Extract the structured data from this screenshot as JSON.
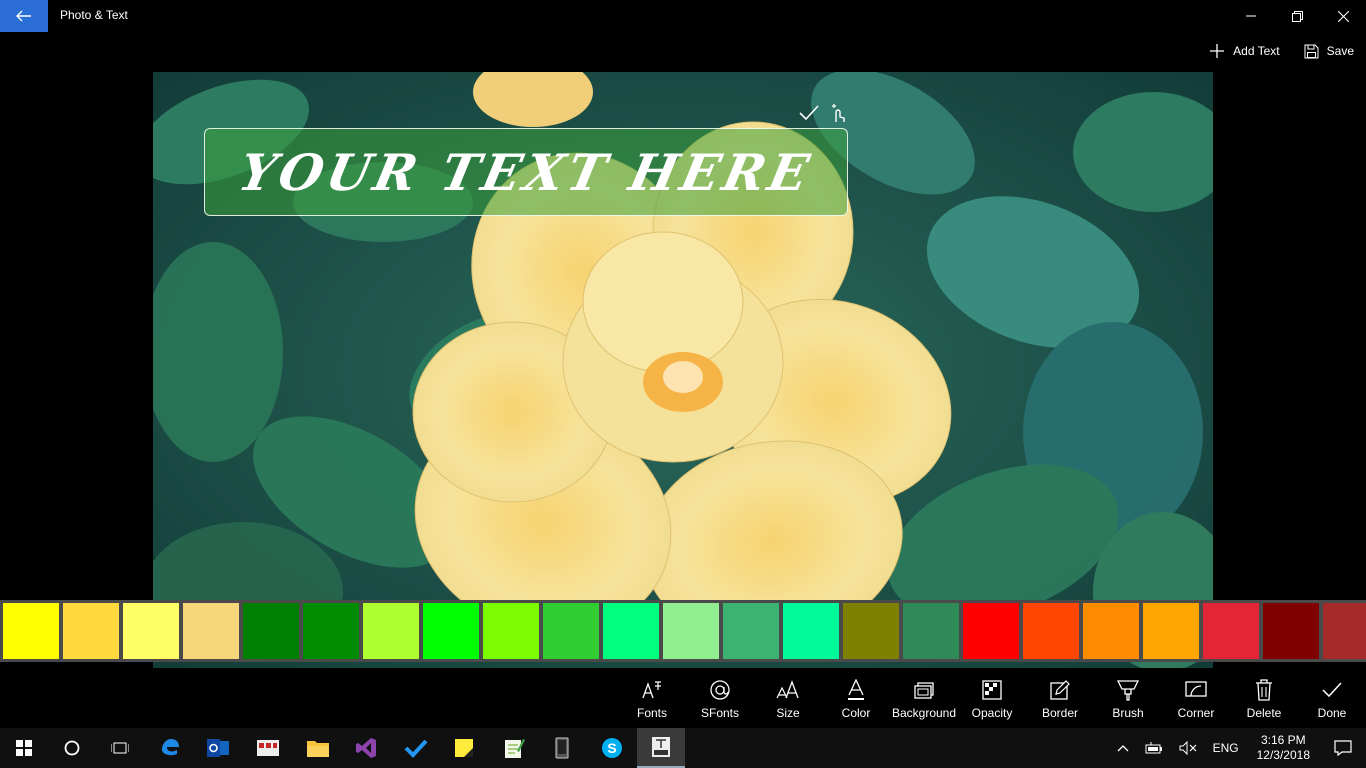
{
  "window": {
    "title": "Photo & Text",
    "back_icon": "arrow-left-icon",
    "controls": [
      "minimize-icon",
      "restore-icon",
      "close-icon"
    ]
  },
  "commands": {
    "add_text": "Add Text",
    "save": "Save"
  },
  "canvas": {
    "overlay_text": "YOUR TEXT HERE",
    "text_box_background": "#3ca03c",
    "tools": [
      "checkmark-icon",
      "touch-move-icon"
    ]
  },
  "palette": {
    "colors": [
      "#ffff00",
      "#ffd93d",
      "#ffff66",
      "#f5d77a",
      "#008000",
      "#008c00",
      "#adff2f",
      "#00ff00",
      "#7cfc00",
      "#32cd32",
      "#00ff7f",
      "#90ee90",
      "#3cb371",
      "#00fa9a",
      "#808000",
      "#2e8b57",
      "#ff0000",
      "#ff4500",
      "#ff8c00",
      "#ffa500",
      "#e32636",
      "#800000",
      "#a52a2a"
    ]
  },
  "toolbar": {
    "items": [
      {
        "label": "Fonts",
        "icon": "fonts-icon"
      },
      {
        "label": "SFonts",
        "icon": "at-sign-icon"
      },
      {
        "label": "Size",
        "icon": "font-size-icon"
      },
      {
        "label": "Color",
        "icon": "font-color-icon"
      },
      {
        "label": "Background",
        "icon": "background-icon"
      },
      {
        "label": "Opacity",
        "icon": "opacity-icon"
      },
      {
        "label": "Border",
        "icon": "border-edit-icon"
      },
      {
        "label": "Brush",
        "icon": "brush-icon"
      },
      {
        "label": "Corner",
        "icon": "corner-icon"
      },
      {
        "label": "Delete",
        "icon": "trash-icon"
      },
      {
        "label": "Done",
        "icon": "checkmark-icon"
      }
    ]
  },
  "taskbar": {
    "apps": [
      "windows-start-icon",
      "cortana-icon",
      "task-view-icon",
      "edge-icon",
      "outlook-icon",
      "app-icon",
      "file-explorer-icon",
      "visual-studio-icon",
      "todo-icon",
      "sticky-notes-icon",
      "notepad-icon",
      "phone-icon",
      "skype-icon",
      "photo-text-icon"
    ],
    "tray": {
      "language": "ENG",
      "time": "3:16 PM",
      "date": "12/3/2018"
    }
  }
}
